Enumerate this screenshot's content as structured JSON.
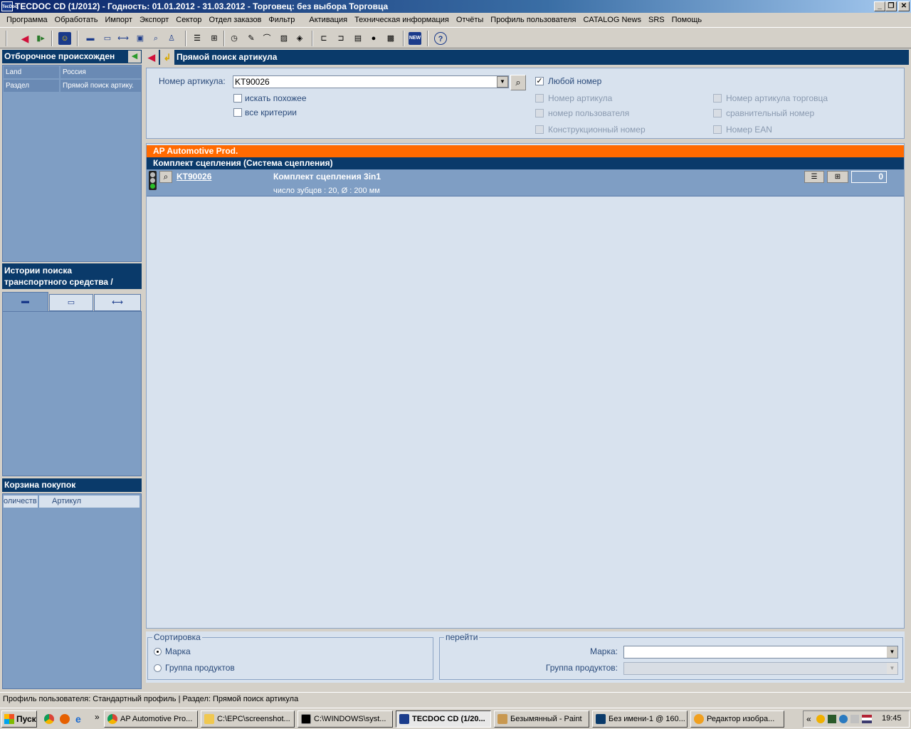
{
  "window": {
    "title": "TECDOC CD (1/2012)  -  Годность: 01.01.2012 - 31.03.2012  -  Торговец: без выбора Торговца",
    "logo_text": "TecDoc"
  },
  "menu": [
    "Программа",
    "Обработать",
    "Импорт",
    "Экспорт",
    "Сектор",
    "Отдел заказов",
    "Фильтр",
    "Активация",
    "Техническая информация",
    "Отчёты",
    "Профиль пользователя",
    "CATALOG News",
    "SRS",
    "Помощь"
  ],
  "toolbar": {
    "help_label": "?",
    "new_label": "NEW"
  },
  "left": {
    "filter_header": "Отборочное происхожден",
    "filter_rows": [
      {
        "key": "Land",
        "value": "Россия"
      },
      {
        "key": "Раздел",
        "value": "Прямой поиск артику."
      }
    ],
    "history_header_line1": "Истории поиска",
    "history_header_line2": "транспортного средства /",
    "cart_header": "Корзина покупок",
    "cart_cols": [
      "оличеств",
      "Артикул"
    ]
  },
  "main": {
    "header": "Прямой поиск артикула",
    "search": {
      "article_label": "Номер артикула:",
      "article_value": "KT90026",
      "similar_label": "искать похожее",
      "all_criteria_label": "все критерии",
      "any_number_label": "Любой номер",
      "opt_article": "Номер артикула",
      "opt_user": "номер пользователя",
      "opt_construction": "Конструкционный номер",
      "opt_trader": "Номер артикула торговца",
      "opt_compare": "сравнительный номер",
      "opt_ean": "Номер EAN"
    },
    "results": {
      "brand": "AP Automotive Prod.",
      "group": "Комплект сцепления (Система сцепления)",
      "item": {
        "number": "KT90026",
        "name": "Комплект сцепления 3in1",
        "details": "число зубцов : 20, Ø : 200 мм",
        "qty": "0"
      }
    },
    "sort": {
      "legend": "Сортировка",
      "opt_brand": "Марка",
      "opt_group": "Группа продуктов"
    },
    "goto": {
      "legend": "перейти",
      "brand_label": "Марка:",
      "group_label": "Группа продуктов:"
    }
  },
  "status": "Профиль пользователя: Стандартный профиль | Раздел: Прямой поиск артикула",
  "taskbar": {
    "start": "Пуск",
    "tasks": [
      "AP Automotive Pro...",
      "C:\\EPC\\screenshot...",
      "C:\\WINDOWS\\syst...",
      "TECDOC CD (1/20...",
      "Безымянный - Paint",
      "Без имени-1 @ 160...",
      "Редактор изобра..."
    ],
    "clock": "19:45"
  }
}
